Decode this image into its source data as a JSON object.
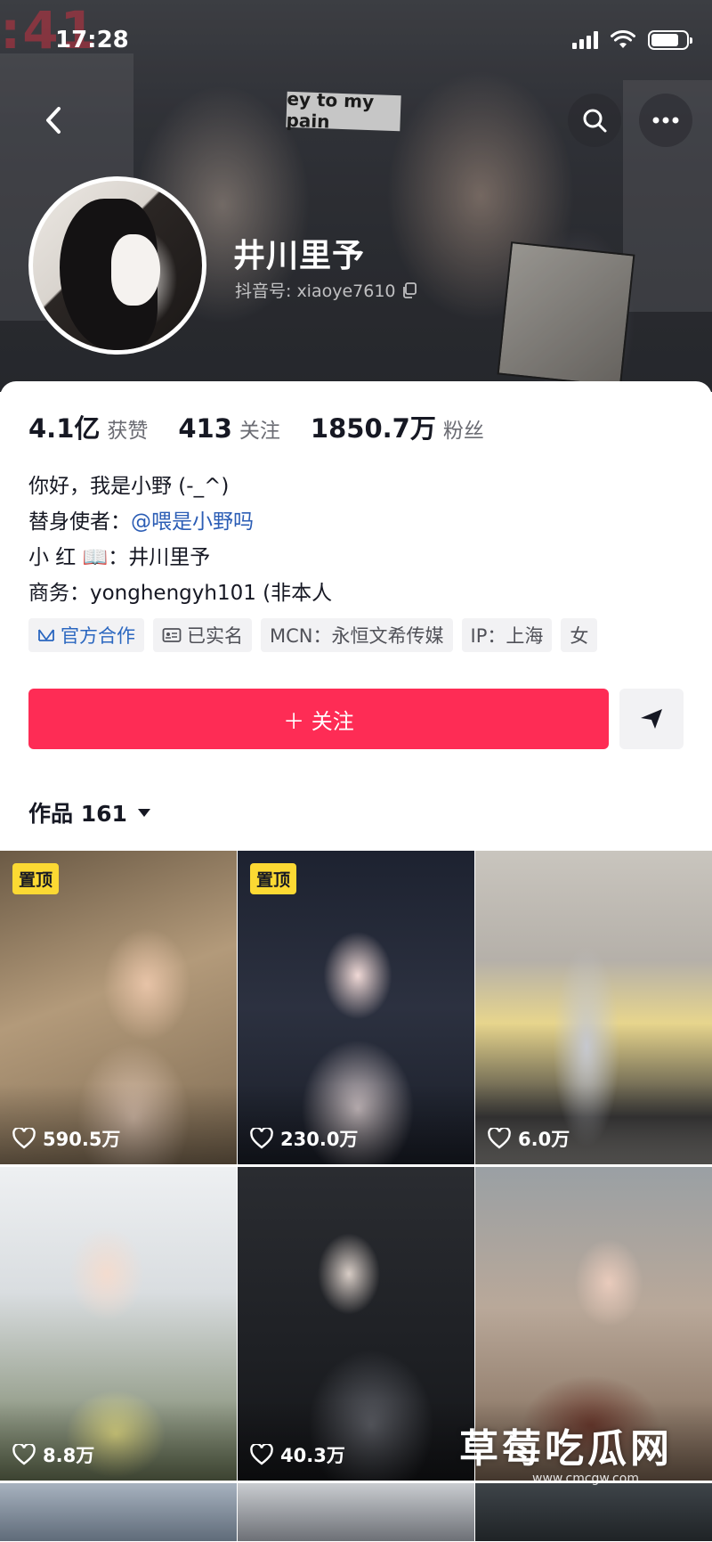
{
  "status_bar": {
    "time": "17:28"
  },
  "banner": {
    "sign_text": "ey to my pain",
    "store_text": ":41"
  },
  "profile": {
    "name": "井川里予",
    "id_label": "抖音号: xiaoye7610"
  },
  "stats": [
    {
      "value": "4.1亿",
      "label": "获赞"
    },
    {
      "value": "413",
      "label": "关注"
    },
    {
      "value": "1850.7万",
      "label": "粉丝"
    }
  ],
  "bio": {
    "line1": "你好，我是小野 (-_^)",
    "line2_prefix": "替身使者：",
    "line2_mention": "@喂是小野吗",
    "line3": "小 红 📖：井川里予",
    "line4": "商务：yonghengyh101 (非本人"
  },
  "tags": [
    {
      "label": "官方合作",
      "icon": "official-icon"
    },
    {
      "label": "已实名",
      "icon": "id-card-icon"
    },
    {
      "label": "MCN：永恒文希传媒"
    },
    {
      "label": "IP：上海"
    },
    {
      "label": "女"
    }
  ],
  "actions": {
    "follow_label": "＋ 关注"
  },
  "works": {
    "label": "作品 161"
  },
  "videos": [
    {
      "pinned": "置顶",
      "likes": "590.5万"
    },
    {
      "pinned": "置顶",
      "likes": "230.0万"
    },
    {
      "likes": "6.0万"
    },
    {
      "likes": "8.8万"
    },
    {
      "likes": "40.3万"
    },
    {
      "likes": ""
    }
  ],
  "watermark": {
    "text": "草莓吃瓜网",
    "url": "www.cmcgw.com"
  },
  "colors": {
    "accent": "#fe2c55",
    "link": "#2b5db5",
    "pin": "#fcd933"
  }
}
